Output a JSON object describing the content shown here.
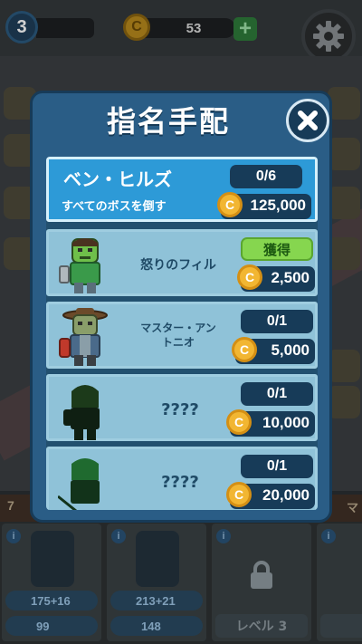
{
  "hud": {
    "level": "3",
    "coins": "53",
    "plus_icon": "+",
    "settings_icon": "gear-icon",
    "coin_symbol": "C"
  },
  "modal": {
    "title": "指名手配",
    "close_icon": "close-icon",
    "boss": {
      "name": "ベン・ヒルズ",
      "subtitle": "すべてのボスを倒す",
      "progress": "0/6",
      "reward": "125,000"
    },
    "targets": [
      {
        "name": "怒りのフィル",
        "status": "獲得",
        "reward": "2,500",
        "claimable": true
      },
      {
        "name_line1": "マスター・アン",
        "name_line2": "トニオ",
        "status": "0/1",
        "reward": "5,000"
      },
      {
        "name": "????",
        "status": "0/1",
        "reward": "10,000"
      },
      {
        "name": "????",
        "status": "0/1",
        "reward": "20,000"
      }
    ]
  },
  "background": {
    "strip_left": "7",
    "strip_right": "マ",
    "cards": [
      {
        "power": "175+16",
        "cost": "99"
      },
      {
        "power": "213+21",
        "cost": "148"
      },
      {
        "level_label": "レベル 3"
      },
      {
        "level_label": "レ"
      }
    ]
  },
  "colors": {
    "modal_bg": "#2a5d86",
    "boss_row": "#2d9ad7",
    "target_row": "#8fc2d8",
    "claim_green": "#86d64f",
    "coin_gold": "#f2b632"
  }
}
